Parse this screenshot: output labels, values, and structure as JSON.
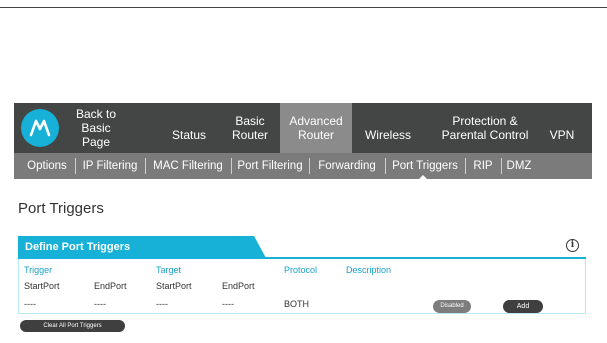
{
  "nav": {
    "items": [
      {
        "line1": "Back to",
        "line2": "Basic Page"
      },
      {
        "line1": "",
        "line2": "Status"
      },
      {
        "line1": "Basic",
        "line2": "Router"
      },
      {
        "line1": "Advanced",
        "line2": "Router"
      },
      {
        "line1": "",
        "line2": "Wireless"
      },
      {
        "line1": "Protection &",
        "line2": "Parental Control"
      },
      {
        "line1": "",
        "line2": "VPN"
      }
    ],
    "active_index": 3
  },
  "subnav": {
    "items": [
      "Options",
      "IP Filtering",
      "MAC Filtering",
      "Port Filtering",
      "Forwarding",
      "Port Triggers",
      "RIP",
      "DMZ"
    ],
    "active": "Port Triggers"
  },
  "page": {
    "title": "Port Triggers",
    "section_title": "Define Port Triggers",
    "info_symbol": "i"
  },
  "table": {
    "headers": {
      "trigger": "Trigger",
      "target": "Target",
      "protocol": "Protocol",
      "description": "Description"
    },
    "subheaders": {
      "trigger_start": "StartPort",
      "trigger_end": "EndPort",
      "target_start": "StartPort",
      "target_end": "EndPort"
    },
    "row": {
      "trigger_start": "----",
      "trigger_end": "----",
      "target_start": "----",
      "target_end": "----",
      "protocol": "BOTH",
      "status_button": "Disabled",
      "add_button": "Add"
    }
  },
  "actions": {
    "clear_all": "Clear All Port Triggers"
  },
  "colors": {
    "accent": "#17b1d8",
    "nav_bg": "#444545",
    "subnav_bg": "#7b7b7b",
    "active_tab": "#8b8b8b"
  },
  "icons": {
    "logo": "motorola-logo",
    "info": "info-icon"
  }
}
